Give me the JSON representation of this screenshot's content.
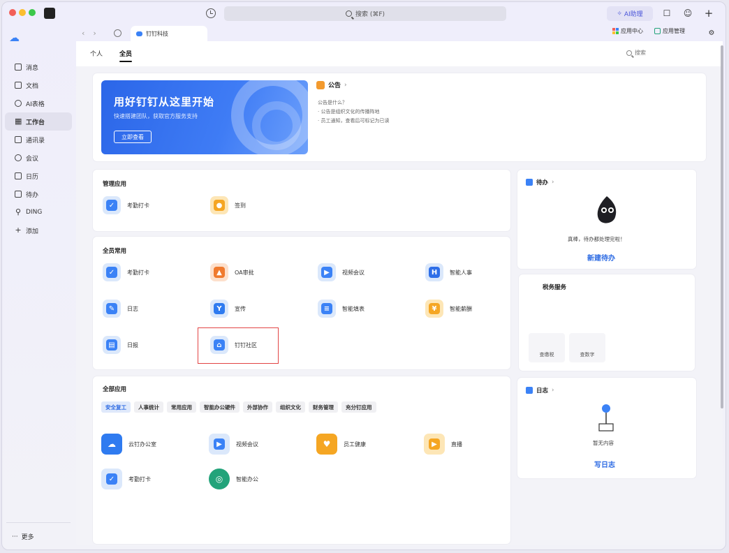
{
  "titlebar": {
    "search_placeholder": "搜索 (⌘F)",
    "ai_button": "AI助理"
  },
  "sidebar": {
    "items": [
      {
        "label": "消息",
        "icon": "message-icon"
      },
      {
        "label": "文档",
        "icon": "doc-icon"
      },
      {
        "label": "AI表格",
        "icon": "ai-table-icon"
      },
      {
        "label": "工作台",
        "icon": "workbench-icon",
        "active": true
      },
      {
        "label": "通讯录",
        "icon": "contacts-icon"
      },
      {
        "label": "会议",
        "icon": "meeting-icon"
      },
      {
        "label": "日历",
        "icon": "calendar-icon"
      },
      {
        "label": "待办",
        "icon": "todo-icon"
      },
      {
        "label": "DING",
        "icon": "ding-icon"
      },
      {
        "label": "添加",
        "icon": "plus-icon"
      }
    ],
    "more": "更多"
  },
  "browser": {
    "tab_title": "钉钉科技",
    "link_app_center": "应用中心",
    "link_app_manage": "应用管理"
  },
  "main": {
    "tabs": [
      "个人",
      "全员"
    ],
    "search_label": "搜索",
    "banner": {
      "title": "用好钉钉从这里开始",
      "subtitle": "快速搭建团队，获取官方服务支持",
      "button": "立即查看"
    },
    "notice": {
      "title": "公告",
      "lines": [
        "公告是什么？",
        "· 公告是组织文化的传播阵地",
        "· 员工通知，查看后可标记为已读"
      ]
    },
    "manage_section": {
      "title": "管理应用",
      "apps": [
        {
          "label": "考勤打卡",
          "color": "#3b82f6"
        },
        {
          "label": "签到",
          "color": "#f5a623"
        }
      ]
    },
    "all_staff_section": {
      "title": "全员常用",
      "apps": [
        {
          "label": "考勤打卡",
          "color": "#3b82f6"
        },
        {
          "label": "OA审批",
          "color": "#f07a2e"
        },
        {
          "label": "视频会议",
          "color": "#3b82f6"
        },
        {
          "label": "智能人事",
          "color": "#2f6fe8"
        },
        {
          "label": "日志",
          "color": "#3b82f6"
        },
        {
          "label": "宣传",
          "color": "#2f7bf0"
        },
        {
          "label": "智能填表",
          "color": "#3b82f6"
        },
        {
          "label": "智能薪酬",
          "color": "#f5a623"
        },
        {
          "label": "日报",
          "color": "#3b82f6"
        },
        {
          "label": "钉钉社区",
          "color": "#3b82f6"
        }
      ]
    },
    "all_apps_section": {
      "title": "全部应用",
      "categories": [
        "安全复工",
        "人事统计",
        "常用应用",
        "智能办公硬件",
        "外部协作",
        "组织文化",
        "财务管理",
        "充分钉应用"
      ],
      "apps": [
        {
          "label": "云钉办公室",
          "color": "#2f7bf0"
        },
        {
          "label": "视频会议",
          "color": "#3b82f6"
        },
        {
          "label": "员工健康",
          "color": "#f5a623"
        },
        {
          "label": "直播",
          "color": "#f5a623"
        },
        {
          "label": "考勤打卡",
          "color": "#3b82f6"
        },
        {
          "label": "智能办公",
          "color": "#22a37a"
        }
      ]
    }
  },
  "right": {
    "todo": {
      "title": "待办",
      "empty": "真棒，待办都处理完啦！",
      "action": "新建待办"
    },
    "tax": {
      "title": "税务服务",
      "items": [
        "查缴税",
        "查数字"
      ]
    },
    "log": {
      "title": "日志",
      "empty": "暂无内容",
      "action": "写日志"
    }
  }
}
